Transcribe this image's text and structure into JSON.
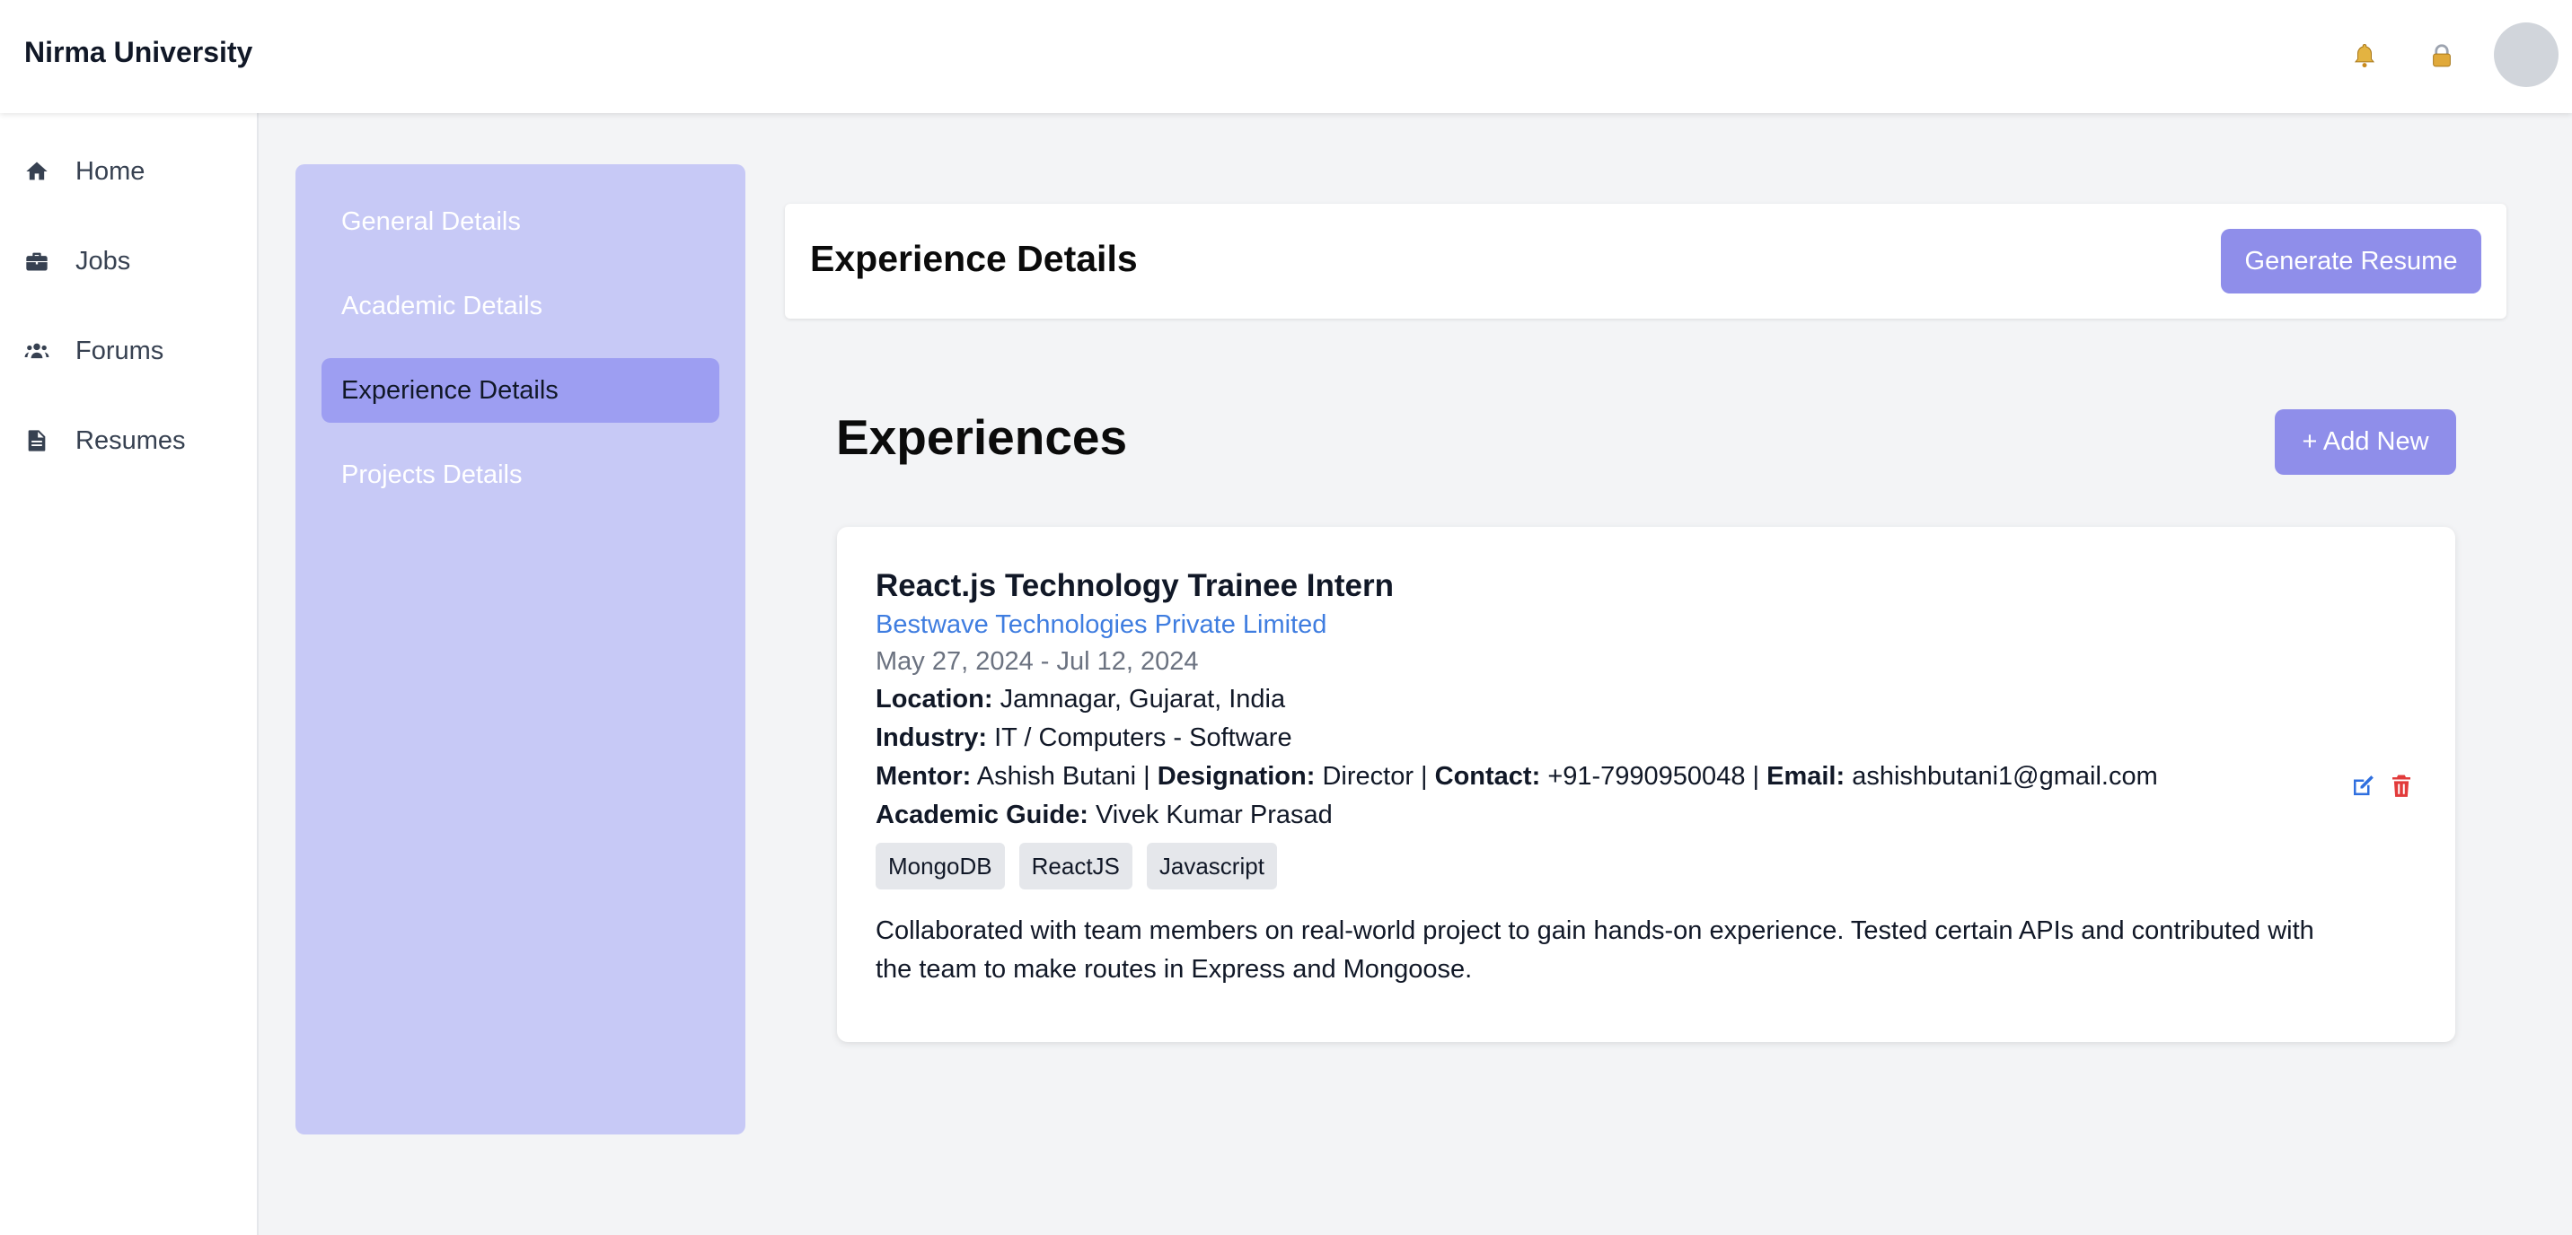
{
  "header": {
    "brand": "Nirma University",
    "icons": [
      "bell-icon",
      "lock-icon",
      "avatar"
    ]
  },
  "sidebar": {
    "items": [
      {
        "label": "Home",
        "icon": "home-icon"
      },
      {
        "label": "Jobs",
        "icon": "briefcase-icon"
      },
      {
        "label": "Forums",
        "icon": "users-icon"
      },
      {
        "label": "Resumes",
        "icon": "document-icon"
      }
    ]
  },
  "submenu": {
    "items": [
      {
        "label": "General Details",
        "active": false
      },
      {
        "label": "Academic Details",
        "active": false
      },
      {
        "label": "Experience Details",
        "active": true
      },
      {
        "label": "Projects Details",
        "active": false
      }
    ]
  },
  "page": {
    "title": "Experience Details",
    "generate_label": "Generate Resume",
    "section_title": "Experiences",
    "add_label": "+ Add New"
  },
  "experience": {
    "role": "React.js Technology Trainee Intern",
    "company": "Bestwave Technologies Private Limited",
    "dates": "May 27, 2024 - Jul 12, 2024",
    "location_label": "Location:",
    "location": "Jamnagar, Gujarat, India",
    "industry_label": "Industry:",
    "industry": "IT / Computers - Software",
    "mentor_label": "Mentor:",
    "mentor": "Ashish Butani",
    "designation_label": "Designation:",
    "designation": "Director",
    "contact_label": "Contact:",
    "contact": "+91-7990950048",
    "email_label": "Email:",
    "email": "ashishbutani1@gmail.com",
    "guide_label": "Academic Guide:",
    "guide": "Vivek Kumar Prasad",
    "skills": [
      "MongoDB",
      "ReactJS",
      "Javascript"
    ],
    "description": "Collaborated with team members on real-world project to gain hands-on experience. Tested certain APIs and contributed with the team to make routes in Express and Mongoose."
  },
  "colors": {
    "accent": "#8f8eea",
    "submenu_bg": "#c7c9f6",
    "submenu_active": "#9d9ef2",
    "link": "#3f7de0",
    "edit_icon": "#2f6fdf",
    "delete_icon": "#e23b3b"
  }
}
